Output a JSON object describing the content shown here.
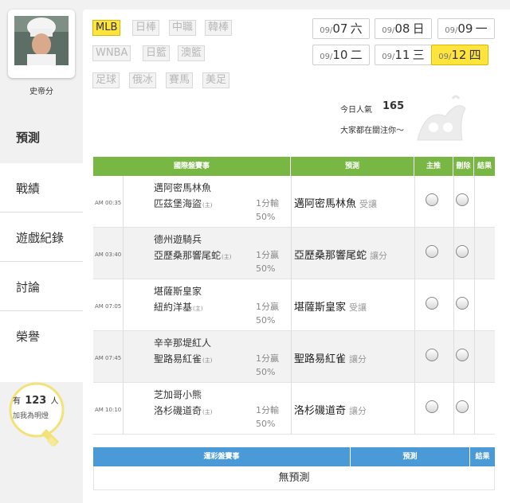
{
  "sidebar": {
    "username": "史帝分",
    "nav": [
      "預測",
      "戰績",
      "遊戲紀錄",
      "討論",
      "榮譽"
    ],
    "bulb": {
      "prefix": "有",
      "count": "123",
      "suffix": "人",
      "subtext": "加我為明燈"
    }
  },
  "leagues": [
    {
      "label": "MLB",
      "active": true
    },
    {
      "label": "日棒"
    },
    {
      "label": "中職"
    },
    {
      "label": "韓棒"
    },
    {
      "label": "WNBA"
    },
    {
      "label": "日籃"
    },
    {
      "label": "澳籃"
    },
    {
      "label": "足球"
    },
    {
      "label": "俄冰"
    },
    {
      "label": "賽馬"
    },
    {
      "label": "美足"
    }
  ],
  "dates": [
    {
      "md": "09/",
      "d": "07",
      "wd": "六"
    },
    {
      "md": "09/",
      "d": "08",
      "wd": "日"
    },
    {
      "md": "09/",
      "d": "09",
      "wd": "一"
    },
    {
      "md": "09/",
      "d": "10",
      "wd": "二"
    },
    {
      "md": "09/",
      "d": "11",
      "wd": "三"
    },
    {
      "md": "09/",
      "d": "12",
      "wd": "四",
      "active": true
    }
  ],
  "popularity": {
    "label": "今日人氣",
    "count": "165",
    "subtext": "大家都在關注你～"
  },
  "intl_table": {
    "headers": [
      "國際盤賽事",
      "預測",
      "主推",
      "刪除",
      "結果"
    ],
    "rows": [
      {
        "time": "AM 00:35",
        "away": "邁阿密馬林魚",
        "home": "匹茲堡海盜",
        "home_mark": "(主)",
        "odds1": "1分輸",
        "odds2": "50%",
        "pick": "邁阿密馬林魚",
        "pick_type": "受讓"
      },
      {
        "time": "AM 03:40",
        "away": "德州遊騎兵",
        "home": "亞歷桑那響尾蛇",
        "home_mark": "(主)",
        "odds1": "1分贏",
        "odds2": "50%",
        "pick": "亞歷桑那響尾蛇",
        "pick_type": "讓分"
      },
      {
        "time": "AM 07:05",
        "away": "堪薩斯皇家",
        "home": "紐約洋基",
        "home_mark": "(主)",
        "odds1": "1分贏",
        "odds2": "50%",
        "pick": "堪薩斯皇家",
        "pick_type": "受讓"
      },
      {
        "time": "AM 07:45",
        "away": "辛辛那堤紅人",
        "home": "聖路易紅雀",
        "home_mark": "(主)",
        "odds1": "1分贏",
        "odds2": "50%",
        "pick": "聖路易紅雀",
        "pick_type": "讓分"
      },
      {
        "time": "AM 10:10",
        "away": "芝加哥小熊",
        "home": "洛杉磯道奇",
        "home_mark": "(主)",
        "odds1": "1分輸",
        "odds2": "50%",
        "pick": "洛杉磯道奇",
        "pick_type": "讓分"
      }
    ]
  },
  "lottery_table": {
    "headers": [
      "運彩盤賽事",
      "預測",
      "結果"
    ],
    "empty_text": "無預測"
  },
  "colors": {
    "accent_yellow": "#ffe43d",
    "header_green": "#78b743",
    "header_blue": "#4a9ad7"
  }
}
